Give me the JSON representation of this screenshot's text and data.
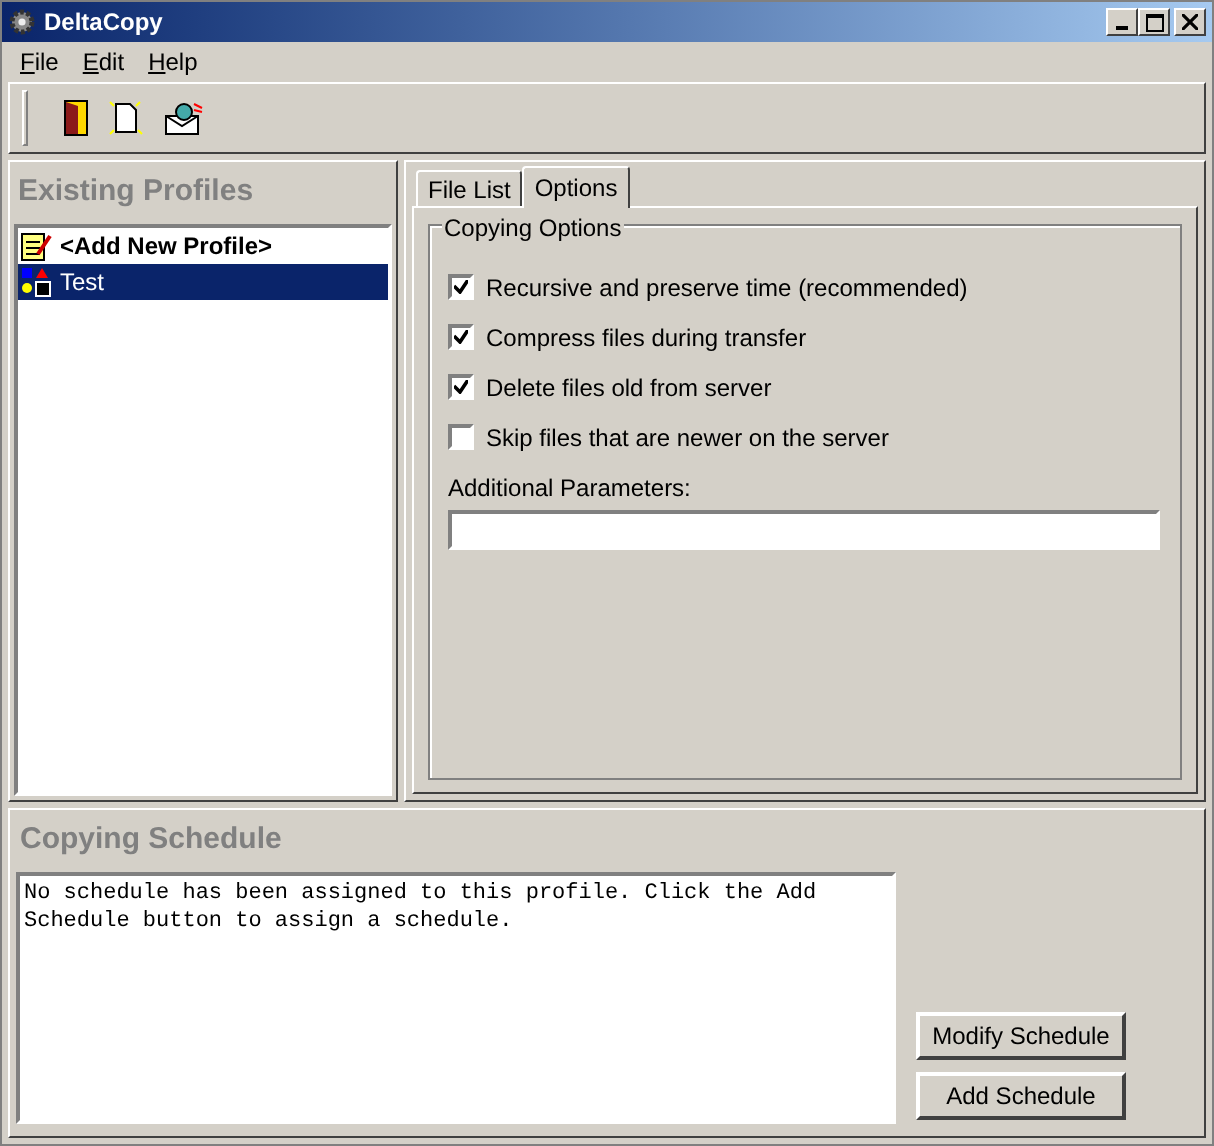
{
  "window": {
    "title": "DeltaCopy"
  },
  "menu": [
    "File",
    "Edit",
    "Help"
  ],
  "profiles_panel": {
    "title": "Existing Profiles",
    "items": [
      {
        "label": "<Add New Profile>",
        "kind": "add",
        "selected": false
      },
      {
        "label": "Test",
        "kind": "profile",
        "selected": true
      }
    ]
  },
  "tabs": [
    {
      "label": "File List",
      "selected": false
    },
    {
      "label": "Options",
      "selected": true
    }
  ],
  "options": {
    "group_title": "Copying Options",
    "checkboxes": [
      {
        "label": "Recursive and preserve time (recommended)",
        "checked": true
      },
      {
        "label": "Compress files during transfer",
        "checked": true
      },
      {
        "label": "Delete files old from server",
        "checked": true
      },
      {
        "label": "Skip files that are newer on the server",
        "checked": false
      }
    ],
    "parameters_label": "Additional Parameters:"
  },
  "schedule": {
    "title": "Copying Schedule",
    "text": "No schedule has been assigned to this profile. Click the Add Schedule button to assign a schedule.",
    "buttons": [
      "Modify Schedule",
      "Add Schedule"
    ]
  }
}
